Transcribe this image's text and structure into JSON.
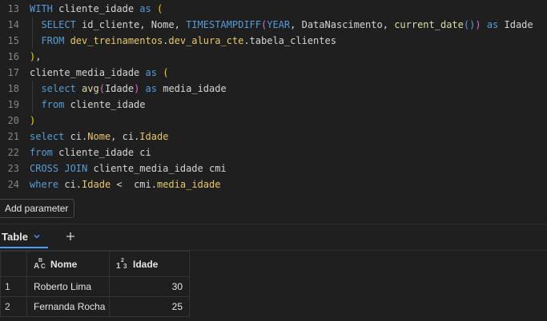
{
  "editor": {
    "lines": [
      {
        "num": "13",
        "tokens": [
          [
            "kw",
            "WITH "
          ],
          [
            "id",
            "cliente_idade "
          ],
          [
            "kw",
            "as "
          ],
          [
            "bp",
            "("
          ]
        ]
      },
      {
        "num": "14",
        "tokens": [
          [
            "id",
            "  "
          ],
          [
            "kw",
            "SELECT "
          ],
          [
            "id",
            "id_cliente, Nome, "
          ],
          [
            "kw",
            "TIMESTAMPDIFF"
          ],
          [
            "bpi",
            "("
          ],
          [
            "kw",
            "YEAR"
          ],
          [
            "id",
            ", DataNascimento, "
          ],
          [
            "fn",
            "current_date"
          ],
          [
            "kw",
            "()"
          ],
          [
            "bpi",
            ")"
          ],
          [
            "id",
            " "
          ],
          [
            "kw",
            "as "
          ],
          [
            "id",
            "Idade"
          ]
        ]
      },
      {
        "num": "15",
        "tokens": [
          [
            "id",
            "  "
          ],
          [
            "kw",
            "FROM "
          ],
          [
            "tbl",
            "dev_treinamentos"
          ],
          [
            "id",
            "."
          ],
          [
            "tbl",
            "dev_alura_cte"
          ],
          [
            "id",
            ".tabela_clientes"
          ]
        ]
      },
      {
        "num": "16",
        "tokens": [
          [
            "bp",
            ")"
          ],
          [
            "id",
            ","
          ]
        ]
      },
      {
        "num": "17",
        "tokens": [
          [
            "id",
            "cliente_media_idade "
          ],
          [
            "kw",
            "as "
          ],
          [
            "bp",
            "("
          ]
        ]
      },
      {
        "num": "18",
        "tokens": [
          [
            "id",
            "  "
          ],
          [
            "kw",
            "select "
          ],
          [
            "fn",
            "avg"
          ],
          [
            "bpi",
            "("
          ],
          [
            "id",
            "Idade"
          ],
          [
            "bpi",
            ")"
          ],
          [
            "id",
            " "
          ],
          [
            "kw",
            "as "
          ],
          [
            "id",
            "media_idade"
          ]
        ]
      },
      {
        "num": "19",
        "tokens": [
          [
            "id",
            "  "
          ],
          [
            "kw",
            "from "
          ],
          [
            "id",
            "cliente_idade"
          ]
        ]
      },
      {
        "num": "20",
        "tokens": [
          [
            "bp",
            ")"
          ]
        ]
      },
      {
        "num": "21",
        "tokens": [
          [
            "kw",
            "select "
          ],
          [
            "id",
            "ci"
          ],
          [
            "id",
            "."
          ],
          [
            "fld",
            "Nome"
          ],
          [
            "id",
            ", ci."
          ],
          [
            "fld",
            "Idade"
          ]
        ]
      },
      {
        "num": "22",
        "tokens": [
          [
            "kw",
            "from "
          ],
          [
            "id",
            "cliente_idade ci"
          ]
        ]
      },
      {
        "num": "23",
        "tokens": [
          [
            "kw",
            "CROSS JOIN "
          ],
          [
            "id",
            "cliente_media_idade cmi"
          ]
        ]
      },
      {
        "num": "24",
        "tokens": [
          [
            "kw",
            "where "
          ],
          [
            "id",
            "ci."
          ],
          [
            "fld",
            "Idade"
          ],
          [
            "id",
            " <  cmi."
          ],
          [
            "fld",
            "media_idade"
          ]
        ]
      }
    ]
  },
  "toolbar": {
    "add_parameter_label": "Add parameter"
  },
  "results": {
    "tab_label": "Table",
    "columns": [
      {
        "type_badge": [
          "A",
          "B",
          "C"
        ],
        "label": "Nome"
      },
      {
        "type_badge": [
          "1",
          "2",
          "3"
        ],
        "label": "Idade"
      }
    ],
    "rows": [
      {
        "idx": "1",
        "nome": "Roberto Lima",
        "idade": "30"
      },
      {
        "idx": "2",
        "nome": "Fernanda Rocha",
        "idade": "25"
      }
    ]
  },
  "colors": {
    "background": "#1f1f1f",
    "keyword": "#569cd6",
    "function": "#dcdcaa",
    "field": "#e8c86a",
    "bracket_outer": "#f1d700",
    "bracket_inner": "#da70d6",
    "accent": "#4a9cff"
  },
  "icons": {
    "tab_dropdown": "chevron-down-icon",
    "add_tab": "plus-icon",
    "string_type": "abc-type-icon",
    "number_type": "123-type-icon"
  }
}
